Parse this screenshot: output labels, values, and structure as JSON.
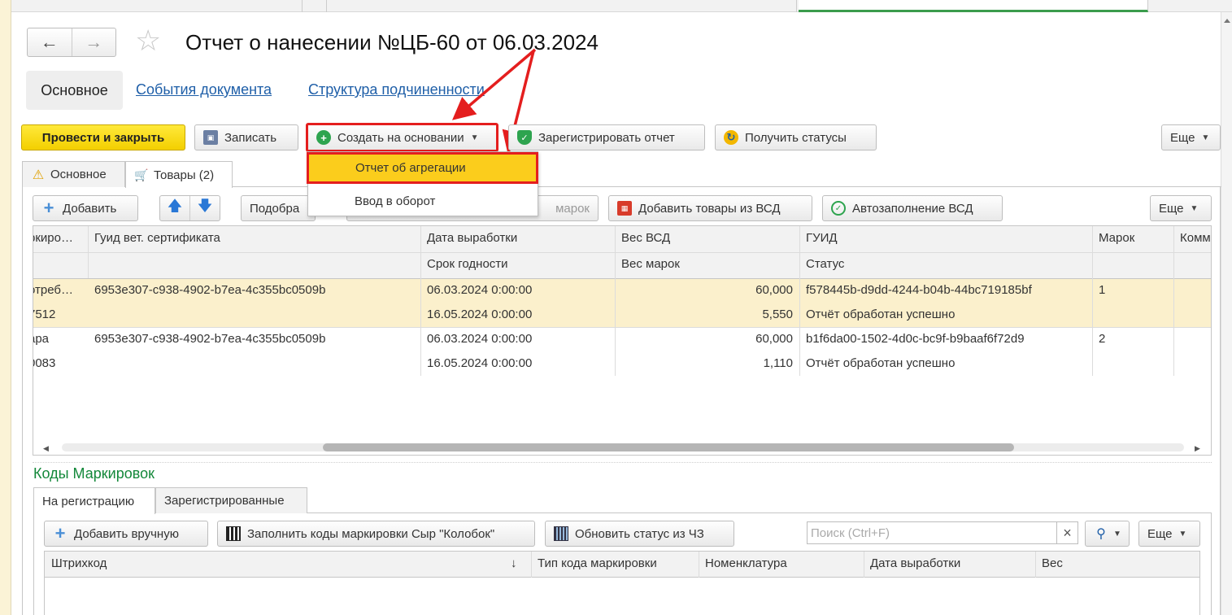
{
  "window": {
    "title": "Отчет о нанесении №ЦБ-60 от 06.03.2024"
  },
  "nav": {
    "tabs": [
      {
        "label": "Основное",
        "active": true
      },
      {
        "label": "События документа"
      },
      {
        "label": "Структура подчиненности"
      }
    ]
  },
  "toolbar": {
    "post_close": "Провести и закрыть",
    "save": "Записать",
    "create_based": "Создать на основании",
    "register_report": "Зарегистрировать отчет",
    "get_statuses": "Получить статусы",
    "more": "Еще"
  },
  "dropdown": {
    "items": [
      "Отчет об агрегации",
      "Ввод в оборот"
    ],
    "selected_index": 0
  },
  "form_tabs": [
    {
      "label": "Основное",
      "icon": "warning-icon"
    },
    {
      "label": "Товары (2)",
      "icon": "cart-icon",
      "active": true
    }
  ],
  "goods_toolbar": {
    "add": "Добавить",
    "pick": "Подобра",
    "marks_partial": "марок",
    "add_from_vsd": "Добавить товары из ВСД",
    "autofill_vsd": "Автозаполнение ВСД",
    "more": "Еще"
  },
  "goods_table": {
    "headers_row1": [
      "ркиро…",
      "Гуид вет. сертификата",
      "Дата выработки",
      "Вес ВСД",
      "ГУИД",
      "Марок",
      "Комм"
    ],
    "headers_row2": [
      "",
      "",
      "Срок годности",
      "Вес марок",
      "Статус",
      "",
      ""
    ],
    "rows": [
      {
        "selected": true,
        "line1": [
          "отреб…",
          "6953e307-c938-4902-b7ea-4c355bc0509b",
          "06.03.2024 0:00:00",
          "60,000",
          "f578445b-d9dd-4244-b04b-44bc719185bf",
          "1",
          ""
        ],
        "line2": [
          "7512",
          "",
          "16.05.2024 0:00:00",
          "5,550",
          "Отчёт обработан успешно",
          "",
          ""
        ]
      },
      {
        "selected": false,
        "line1": [
          "ара",
          "6953e307-c938-4902-b7ea-4c355bc0509b",
          "06.03.2024 0:00:00",
          "60,000",
          "b1f6da00-1502-4d0c-bc9f-b9baaf6f72d9",
          "2",
          ""
        ],
        "line2": [
          "0083",
          "",
          "16.05.2024 0:00:00",
          "1,110",
          "Отчёт обработан успешно",
          "",
          ""
        ]
      }
    ]
  },
  "codes": {
    "title": "Коды Маркировок",
    "tabs": [
      {
        "label": "На регистрацию",
        "active": true
      },
      {
        "label": "Зарегистрированные"
      }
    ],
    "add_manual": "Добавить вручную",
    "fill_codes": "Заполнить коды маркировки Сыр \"Колобок\"",
    "update_status": "Обновить статус из ЧЗ",
    "search_placeholder": "Поиск (Ctrl+F)",
    "clear": "×",
    "more": "Еще",
    "headers": [
      "Штрихкод",
      "↓",
      "Тип кода маркировки",
      "Номенклатура",
      "Дата выработки",
      "Вес"
    ]
  },
  "colors": {
    "accent_yellow": "#f3cf00",
    "highlight_row": "#fbf0cc",
    "annotation_red": "#e41e1e",
    "section_green": "#13883a",
    "link_blue": "#1f5fa8"
  }
}
